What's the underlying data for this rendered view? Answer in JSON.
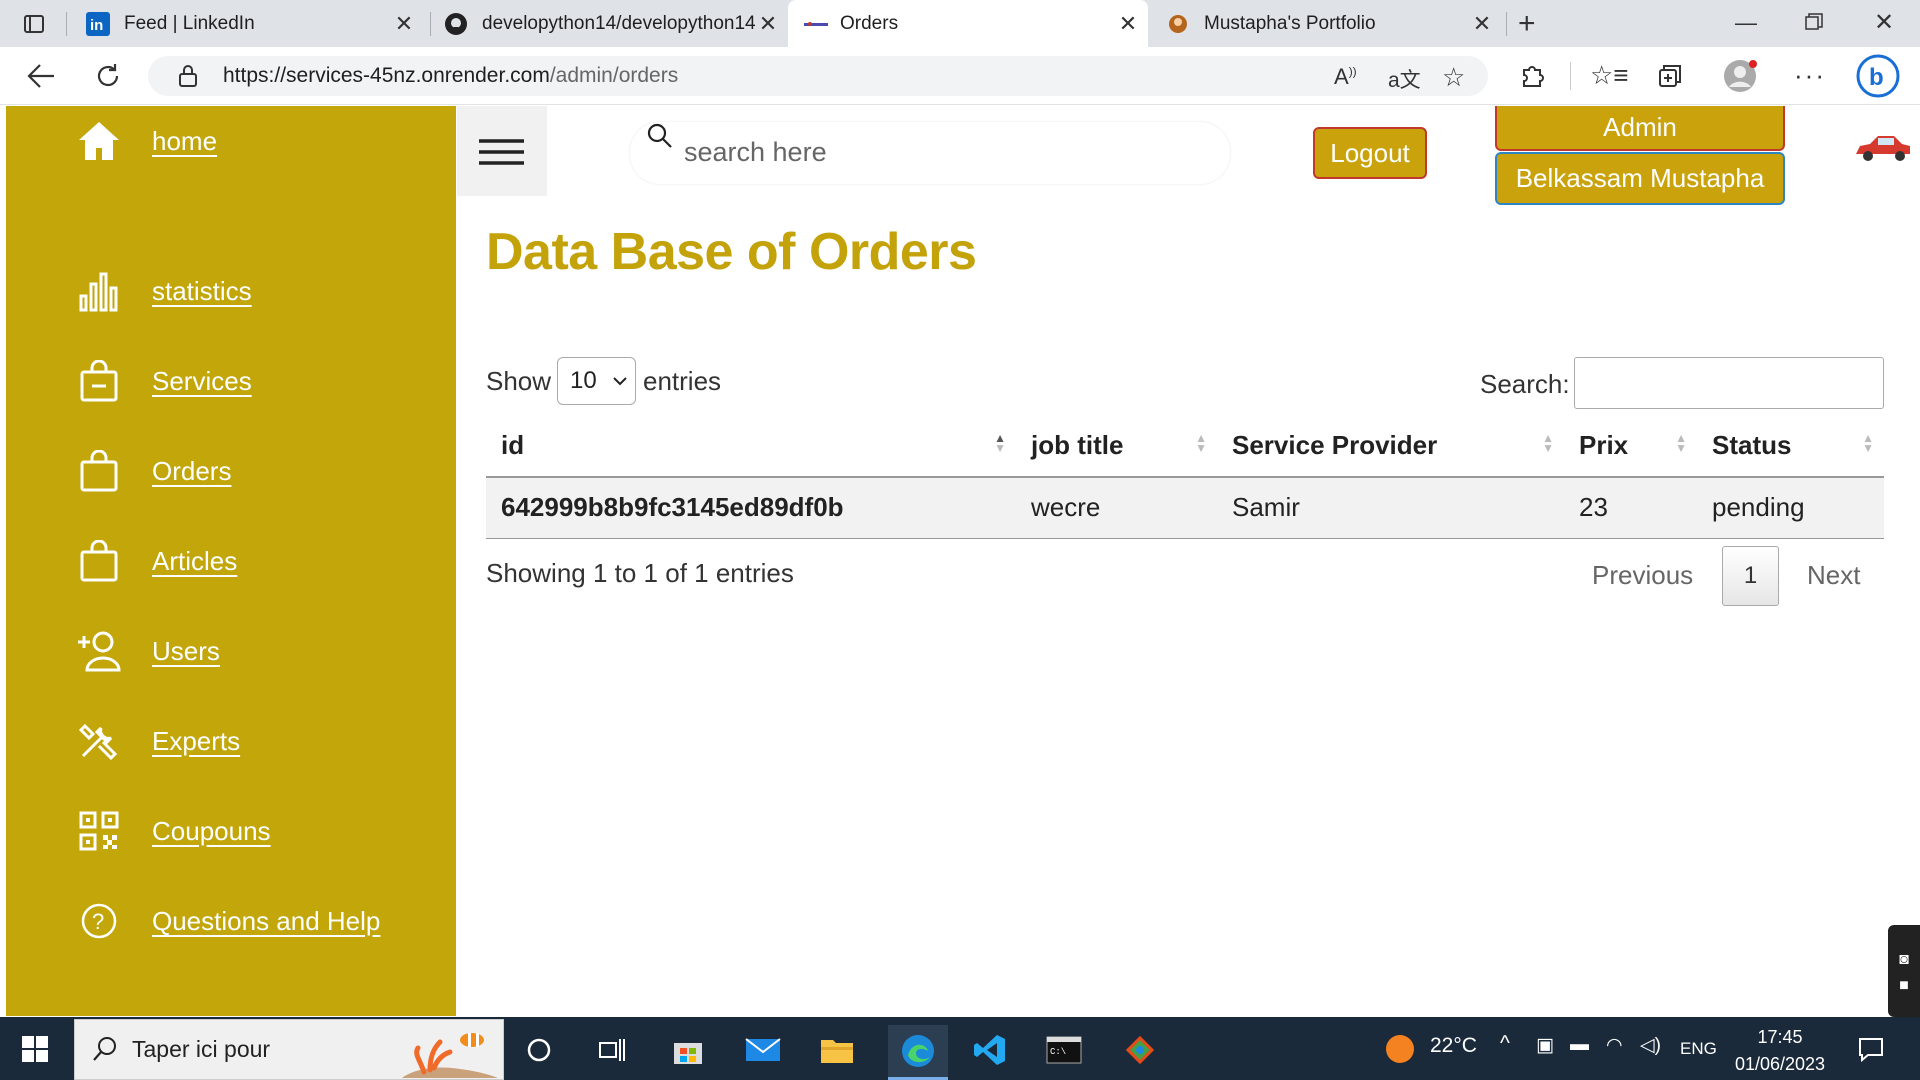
{
  "browser": {
    "tabs": [
      {
        "title": "Feed | LinkedIn",
        "icon": "linkedin-icon"
      },
      {
        "title": "developython14/developython14",
        "icon": "github-icon"
      },
      {
        "title": "Orders",
        "icon": "site-favicon",
        "active": true
      },
      {
        "title": "Mustapha's Portfolio",
        "icon": "portfolio-favicon"
      }
    ],
    "url_host": "https://services-45nz.onrender.com",
    "url_path": "/admin/orders"
  },
  "sidebar": {
    "items": [
      {
        "label": "home",
        "icon": "home-icon"
      },
      {
        "label": "statistics",
        "icon": "bar-chart-icon"
      },
      {
        "label": "Services",
        "icon": "bag-minus-icon"
      },
      {
        "label": "Orders",
        "icon": "bag-icon"
      },
      {
        "label": "Articles",
        "icon": "bag-icon"
      },
      {
        "label": "Users",
        "icon": "user-add-icon"
      },
      {
        "label": "Experts",
        "icon": "tools-icon"
      },
      {
        "label": "Coupouns",
        "icon": "qr-code-icon"
      },
      {
        "label": "Questions and Help",
        "icon": "question-icon"
      }
    ]
  },
  "header": {
    "search_placeholder": "search here",
    "logout_label": "Logout",
    "admin_label": "Admin",
    "user_name": "Belkassam Mustapha"
  },
  "main": {
    "title": "Data Base of Orders",
    "show_label": "Show",
    "entries_label": "entries",
    "page_length": "10",
    "search_label": "Search:",
    "columns": [
      "id",
      "job title",
      "Service Provider",
      "Prix",
      "Status"
    ],
    "rows": [
      {
        "id": "642999b8b9fc3145ed89df0b",
        "job_title": "wecre",
        "provider": "Samir",
        "prix": "23",
        "status": "pending"
      }
    ],
    "info": "Showing 1 to 1 of 1 entries",
    "previous_label": "Previous",
    "current_page": "1",
    "next_label": "Next"
  },
  "taskbar": {
    "search_text": "Taper ici pour",
    "temperature": "22°C",
    "language": "ENG",
    "time": "17:45",
    "date": "01/06/2023"
  },
  "colors": {
    "accent": "#c2a60a",
    "title": "#c3a20a"
  }
}
